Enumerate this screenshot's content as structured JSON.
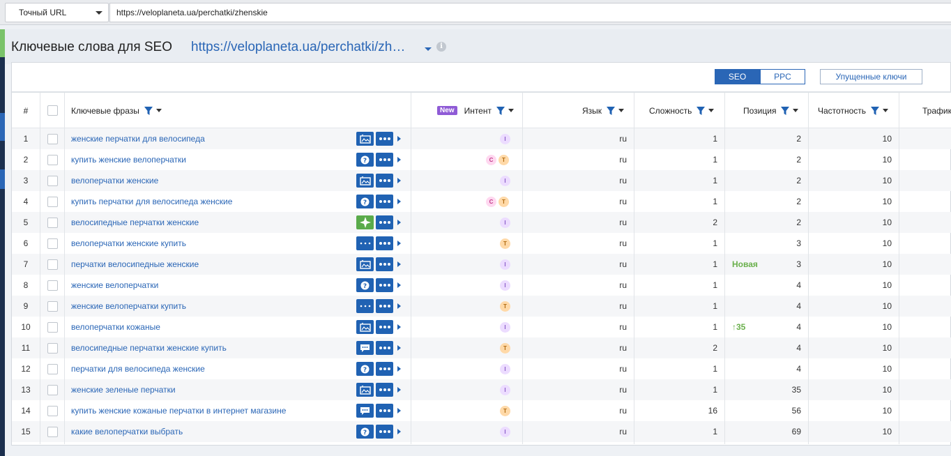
{
  "topbar": {
    "match_type": "Точный URL",
    "url_value": "https://veloplaneta.ua/perchatki/zhenskie"
  },
  "header": {
    "title": "Ключевые слова для SEO",
    "url_link": "https://veloplaneta.ua/perchatki/zh…"
  },
  "tabs": {
    "seo": "SEO",
    "ppc": "PPC",
    "missed": "Упущенные ключи"
  },
  "columns": {
    "num": "#",
    "keyword": "Ключевые фразы",
    "new": "New",
    "intent": "Интент",
    "lang": "Язык",
    "difficulty": "Сложность",
    "position": "Позиция",
    "frequency": "Частотность",
    "traffic": "Трафик"
  },
  "rows": [
    {
      "n": "1",
      "kw": "женские перчатки для велосипеда",
      "serp": "image-icon",
      "intent": [
        "I"
      ],
      "lang": "ru",
      "diff": "1",
      "change": "",
      "pos": "2",
      "freq": "10"
    },
    {
      "n": "2",
      "kw": "купить женские велоперчатки",
      "serp": "question-icon",
      "intent": [
        "C",
        "T"
      ],
      "lang": "ru",
      "diff": "1",
      "change": "",
      "pos": "2",
      "freq": "10"
    },
    {
      "n": "3",
      "kw": "велоперчатки женские",
      "serp": "image-icon",
      "intent": [
        "I"
      ],
      "lang": "ru",
      "diff": "1",
      "change": "",
      "pos": "2",
      "freq": "10"
    },
    {
      "n": "4",
      "kw": "купить перчатки для велосипеда женские",
      "serp": "question-icon",
      "intent": [
        "C",
        "T"
      ],
      "lang": "ru",
      "diff": "1",
      "change": "",
      "pos": "2",
      "freq": "10"
    },
    {
      "n": "5",
      "kw": "велосипедные перчатки женские",
      "serp": "sparkle-icon",
      "intent": [
        "I"
      ],
      "lang": "ru",
      "diff": "2",
      "change": "",
      "pos": "2",
      "freq": "10"
    },
    {
      "n": "6",
      "kw": "велоперчатки женские купить",
      "serp": "carousel-icon",
      "intent": [
        "T"
      ],
      "lang": "ru",
      "diff": "1",
      "change": "",
      "pos": "3",
      "freq": "10"
    },
    {
      "n": "7",
      "kw": "перчатки велосипедные женские",
      "serp": "image-icon",
      "intent": [
        "I"
      ],
      "lang": "ru",
      "diff": "1",
      "change": "Новая",
      "pos": "3",
      "freq": "10"
    },
    {
      "n": "8",
      "kw": "женские велоперчатки",
      "serp": "question-icon",
      "intent": [
        "I"
      ],
      "lang": "ru",
      "diff": "1",
      "change": "",
      "pos": "4",
      "freq": "10"
    },
    {
      "n": "9",
      "kw": "женские велоперчатки купить",
      "serp": "carousel-icon",
      "intent": [
        "T"
      ],
      "lang": "ru",
      "diff": "1",
      "change": "",
      "pos": "4",
      "freq": "10"
    },
    {
      "n": "10",
      "kw": "велоперчатки кожаные",
      "serp": "image-icon",
      "intent": [
        "I"
      ],
      "lang": "ru",
      "diff": "1",
      "change": "↑35",
      "pos": "4",
      "freq": "10"
    },
    {
      "n": "11",
      "kw": "велосипедные перчатки женские купить",
      "serp": "review-icon",
      "intent": [
        "T"
      ],
      "lang": "ru",
      "diff": "2",
      "change": "",
      "pos": "4",
      "freq": "10"
    },
    {
      "n": "12",
      "kw": "перчатки для велосипеда женские",
      "serp": "question-icon",
      "intent": [
        "I"
      ],
      "lang": "ru",
      "diff": "1",
      "change": "",
      "pos": "4",
      "freq": "10"
    },
    {
      "n": "13",
      "kw": "женские зеленые перчатки",
      "serp": "image-icon",
      "intent": [
        "I"
      ],
      "lang": "ru",
      "diff": "1",
      "change": "",
      "pos": "35",
      "freq": "10"
    },
    {
      "n": "14",
      "kw": "купить женские кожаные перчатки в интернет магазине",
      "serp": "review-icon",
      "intent": [
        "T"
      ],
      "lang": "ru",
      "diff": "16",
      "change": "",
      "pos": "56",
      "freq": "10"
    },
    {
      "n": "15",
      "kw": "какие велоперчатки выбрать",
      "serp": "question-icon",
      "intent": [
        "I"
      ],
      "lang": "ru",
      "diff": "1",
      "change": "",
      "pos": "69",
      "freq": "10"
    }
  ],
  "colors": {
    "accent": "#2a66b6",
    "green": "#6ab04c",
    "intent_i": "#ecdcff",
    "intent_c": "#ffd8f0",
    "intent_t": "#ffd9a8"
  }
}
